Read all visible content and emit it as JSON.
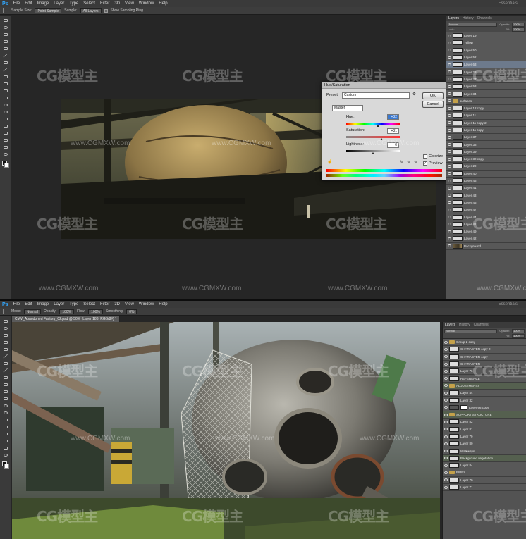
{
  "top_screenshot": {
    "app_logo": "Ps",
    "menu": [
      "File",
      "Edit",
      "Image",
      "Layer",
      "Type",
      "Select",
      "Filter",
      "3D",
      "View",
      "Window",
      "Help"
    ],
    "workspace": "Essentials",
    "options": {
      "sample_size_label": "Sample Size:",
      "sample_size_value": "Point Sample",
      "sample_label": "Sample:",
      "sample_value": "All Layers",
      "show_ring_label": "Show Sampling Ring"
    },
    "panel_tabs": [
      "Layers",
      "History",
      "Channels"
    ],
    "blend_mode": "Normal",
    "opacity_label": "Opacity:",
    "opacity_value": "100%",
    "lock_label": "Lock:",
    "fill_label": "Fill:",
    "fill_value": "100%",
    "layers": [
      {
        "name": "Layer 19",
        "thumb": "white"
      },
      {
        "name": "Yellow",
        "thumb": "white"
      },
      {
        "name": "Layer 50",
        "thumb": "white"
      },
      {
        "name": "Layer 52",
        "thumb": "white"
      },
      {
        "name": "Layer 63",
        "thumb": "white",
        "selected": true
      },
      {
        "name": "Layer 28...",
        "thumb": "white"
      },
      {
        "name": "Layer 27",
        "thumb": "white"
      },
      {
        "name": "Layer 53",
        "thumb": "white"
      },
      {
        "name": "Layer 34",
        "thumb": "white"
      },
      {
        "name": "surfaces",
        "thumb": "folder"
      },
      {
        "name": "Layer 12 copy",
        "thumb": "white"
      },
      {
        "name": "Layer 11",
        "thumb": "white"
      },
      {
        "name": "Layer 11 copy 2",
        "thumb": "white"
      },
      {
        "name": "Layer 11 copy",
        "thumb": "white"
      },
      {
        "name": "Layer 37",
        "thumb": "dark"
      },
      {
        "name": "Layer 38",
        "thumb": "white"
      },
      {
        "name": "Layer 39",
        "thumb": "white"
      },
      {
        "name": "Layer 32 copy",
        "thumb": "white"
      },
      {
        "name": "Layer 29",
        "thumb": "white"
      },
      {
        "name": "Layer 40",
        "thumb": "white"
      },
      {
        "name": "Layer 46",
        "thumb": "white"
      },
      {
        "name": "Layer 41",
        "thumb": "white"
      },
      {
        "name": "Layer 43",
        "thumb": "white"
      },
      {
        "name": "Layer 45",
        "thumb": "white"
      },
      {
        "name": "Layer 47",
        "thumb": "white"
      },
      {
        "name": "Layer 44",
        "thumb": "white"
      },
      {
        "name": "Layer 48",
        "thumb": "white"
      },
      {
        "name": "Layer 49",
        "thumb": "white"
      },
      {
        "name": "Layer 42",
        "thumb": "white"
      },
      {
        "name": "Background",
        "thumb": "img"
      }
    ],
    "dialog": {
      "title": "Hue/Saturation",
      "preset_label": "Preset:",
      "preset_value": "Custom",
      "channel_value": "Master",
      "hue_label": "Hue:",
      "hue_value": "+32",
      "saturation_label": "Saturation:",
      "saturation_value": "+31",
      "lightness_label": "Lightness:",
      "lightness_value": "0",
      "ok_label": "OK",
      "cancel_label": "Cancel",
      "colorize_label": "Colorize",
      "colorize_checked": false,
      "preview_label": "Preview",
      "preview_checked": true,
      "hue_fraction": 0.59,
      "saturation_fraction": 0.66,
      "lightness_fraction": 0.5
    }
  },
  "bottom_screenshot": {
    "app_logo": "Ps",
    "menu": [
      "File",
      "Edit",
      "Image",
      "Layer",
      "Type",
      "Select",
      "Filter",
      "3D",
      "View",
      "Window",
      "Help"
    ],
    "workspace": "Essentials",
    "document_tab": "CMV_Abandoned Factory_02.psd @ 50% (Layer 183, RGB/8#) *",
    "options": {
      "mode_label": "Mode:",
      "mode_value": "Normal",
      "opacity_label": "Opacity:",
      "opacity_value": "100%",
      "flow_label": "Flow:",
      "flow_value": "100%",
      "smoothing_label": "Smoothing:",
      "smoothing_value": "0%"
    },
    "panel_tabs": [
      "Layers",
      "History",
      "Channels"
    ],
    "blend_mode": "Normal",
    "opacity_label": "Opacity:",
    "opacity_value": "100%",
    "fill_label": "Fill:",
    "fill_value": "100%",
    "layers": [
      {
        "name": "Group 2 copy",
        "thumb": "folder"
      },
      {
        "name": "CHARACTER copy 2",
        "thumb": "white"
      },
      {
        "name": "CHARACTER copy",
        "thumb": "white"
      },
      {
        "name": "CHARACTER",
        "thumb": "white"
      },
      {
        "name": "Layer 76",
        "thumb": "white"
      },
      {
        "name": "REFERENCE",
        "thumb": "white"
      },
      {
        "name": "ADJUSTMENTS",
        "thumb": "folder",
        "green": true
      },
      {
        "name": "Layer 44",
        "thumb": "white"
      },
      {
        "name": "Layer 32",
        "thumb": "white"
      },
      {
        "name": "Layer 66 copy",
        "thumb": "dark",
        "mask": true
      },
      {
        "name": "SUPPORT STRUCTURE",
        "thumb": "folder",
        "green": true
      },
      {
        "name": "Layer 82",
        "thumb": "white"
      },
      {
        "name": "Layer 81",
        "thumb": "white"
      },
      {
        "name": "Layer 79",
        "thumb": "white"
      },
      {
        "name": "Layer 80",
        "thumb": "white"
      },
      {
        "name": "Walkways",
        "thumb": "white"
      },
      {
        "name": "Background vegetation",
        "thumb": "white",
        "green": true
      },
      {
        "name": "Layer 84",
        "thumb": "white"
      },
      {
        "name": "PIPES",
        "thumb": "folder"
      },
      {
        "name": "Layer 70",
        "thumb": "white"
      },
      {
        "name": "Layer 71",
        "thumb": "white"
      }
    ]
  },
  "watermarks": {
    "brand": "CG模型主",
    "url": "www.CGMXW.com"
  }
}
